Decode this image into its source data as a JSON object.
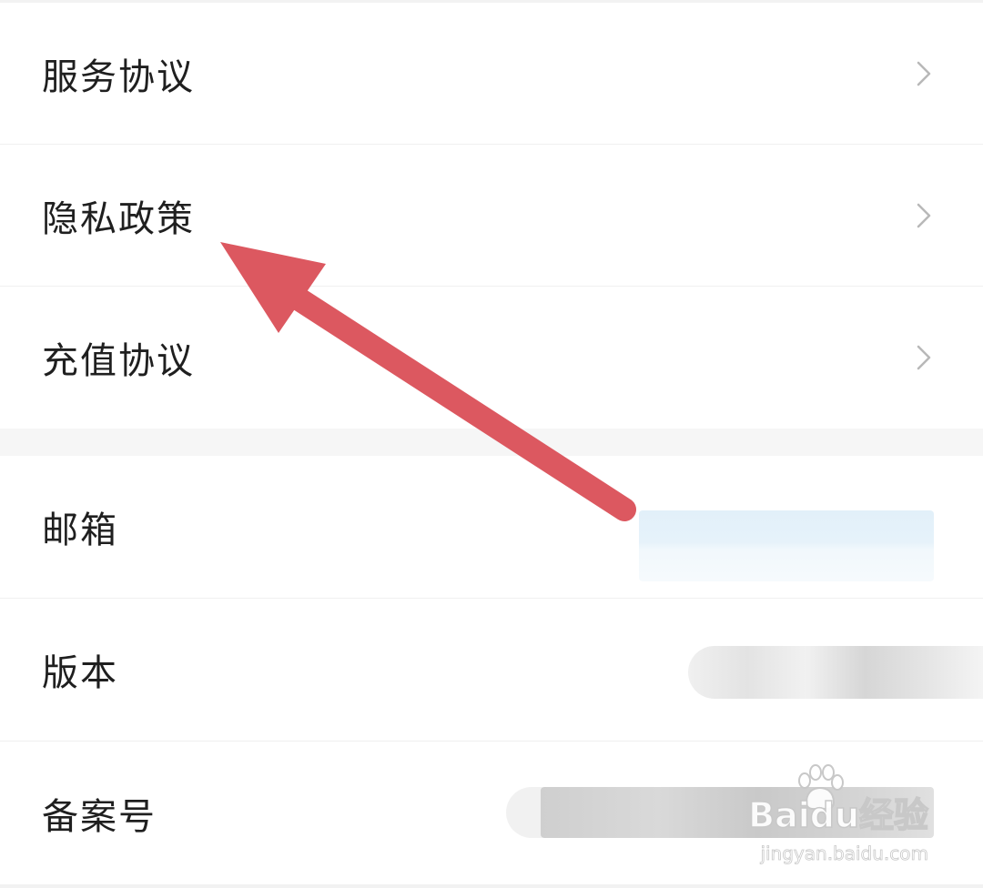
{
  "settings": {
    "agreements": [
      {
        "label": "服务协议"
      },
      {
        "label": "隐私政策"
      },
      {
        "label": "充值协议"
      }
    ],
    "info": {
      "email_label": "邮箱",
      "version_label": "版本",
      "record_label": "备案号"
    }
  },
  "annotation": {
    "arrow_color": "#dc5860"
  },
  "watermark": {
    "brand": "Baidu经验",
    "url": "jingyan.baidu.com"
  }
}
